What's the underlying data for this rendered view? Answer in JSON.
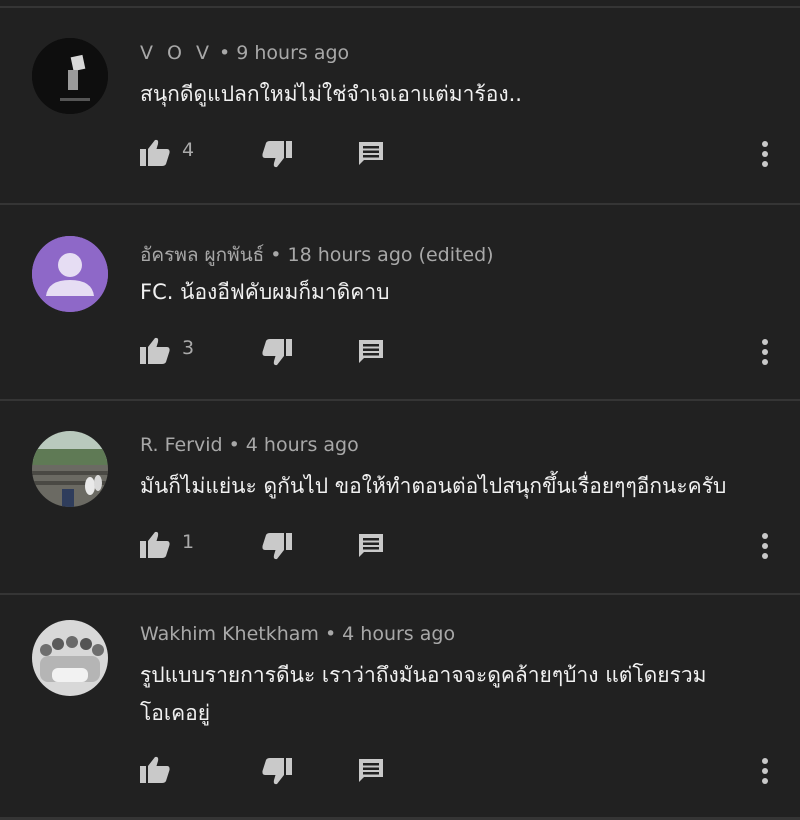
{
  "comments": [
    {
      "author": "V O V",
      "time": "9 hours ago",
      "text_lines": [
        "สนุกดีดูแปลกใหม่ไม่ใช่จำเจเอาแต่มาร้อง.."
      ],
      "likes": "4",
      "avatar": "dark-photo"
    },
    {
      "author": "อัครพล ผูกพันธ์",
      "time": "18 hours ago (edited)",
      "text_lines": [
        "FC. น้องอีฟคับผมก็มาดิคาบ"
      ],
      "likes": "3",
      "avatar": "default-user-purple"
    },
    {
      "author": "R. Fervid",
      "time": "4 hours ago",
      "text_lines": [
        "มันก็ไม่แย่นะ ดูกันไป ขอให้ทำตอนต่อไปสนุกขึ้นเรื่อยๆๆอีกนะครับ"
      ],
      "likes": "1",
      "avatar": "outdoor-photo"
    },
    {
      "author": "Wakhim Khetkham",
      "time": "4 hours ago",
      "text_lines": [
        "รูปแบบรายการดีนะ เราว่าถึงมันอาจจะดูคล้ายๆบ้าง แต่โดยรวม",
        "โอเคอยู่"
      ],
      "likes": "",
      "avatar": "group-photo"
    }
  ],
  "separator": "•",
  "colors": {
    "background": "#212121",
    "divider": "#353535",
    "text": "#f1f1f1",
    "meta": "#a8a8a8",
    "icon": "#c9c9c9",
    "avatar_purple": "#8e68c8"
  },
  "icons": [
    "thumb-up-icon",
    "thumb-down-icon",
    "reply-icon",
    "more-vert-icon"
  ]
}
